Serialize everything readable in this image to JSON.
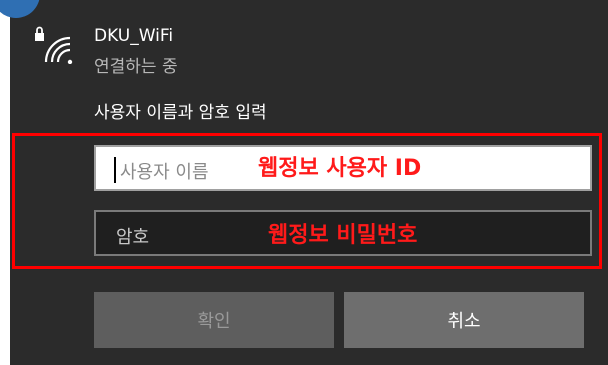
{
  "network": {
    "ssid": "DKU_WiFi",
    "status": "연결하는 중",
    "icon": "wifi-secured-icon"
  },
  "credentials": {
    "prompt": "사용자 이름과 암호 입력",
    "username_placeholder": "사용자 이름",
    "password_placeholder": "암호"
  },
  "annotations": {
    "username_hint": "웹정보 사용자 ID",
    "password_hint": "웹정보 비밀번호",
    "color": "#ff0000"
  },
  "buttons": {
    "ok": "확인",
    "cancel": "취소"
  },
  "colors": {
    "panel_bg": "#2b2b2b",
    "accent": "#2f6fb3"
  }
}
